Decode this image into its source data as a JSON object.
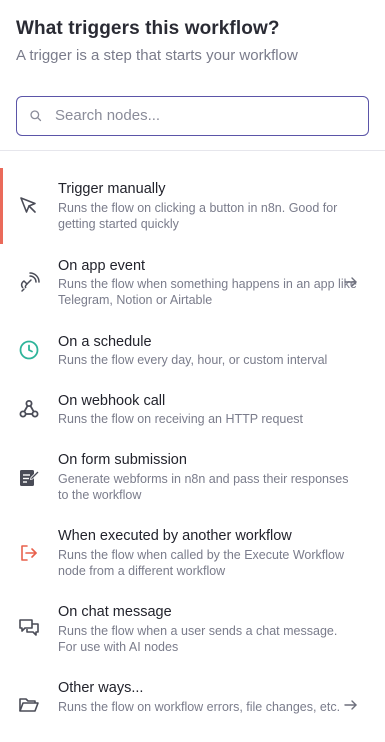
{
  "header": {
    "title": "What triggers this workflow?",
    "subtitle": "A trigger is a step that starts your workflow"
  },
  "search": {
    "placeholder": "Search nodes...",
    "value": ""
  },
  "colors": {
    "accent_active": "#ea6a5a",
    "search_border": "#5b55a8",
    "schedule_icon": "#2eb49a",
    "workflow_icon": "#e8604c"
  },
  "triggers": [
    {
      "name": "Trigger manually",
      "description": "Runs the flow on clicking a button in n8n. Good for getting started quickly",
      "icon": "cursor-icon",
      "active": true,
      "has_arrow": false
    },
    {
      "name": "On app event",
      "description": "Runs the flow when something happens in an app like Telegram, Notion or Airtable",
      "icon": "app-event-icon",
      "active": false,
      "has_arrow": true
    },
    {
      "name": "On a schedule",
      "description": "Runs the flow every day, hour, or custom interval",
      "icon": "clock-icon",
      "active": false,
      "has_arrow": false
    },
    {
      "name": "On webhook call",
      "description": "Runs the flow on receiving an HTTP request",
      "icon": "webhook-icon",
      "active": false,
      "has_arrow": false
    },
    {
      "name": "On form submission",
      "description": "Generate webforms in n8n and pass their responses to the workflow",
      "icon": "form-icon",
      "active": false,
      "has_arrow": false
    },
    {
      "name": "When executed by another workflow",
      "description": "Runs the flow when called by the Execute Workflow node from a different workflow",
      "icon": "sign-in-icon",
      "active": false,
      "has_arrow": false
    },
    {
      "name": "On chat message",
      "description": "Runs the flow when a user sends a chat message. For use with AI nodes",
      "icon": "chat-icon",
      "active": false,
      "has_arrow": false
    },
    {
      "name": "Other ways...",
      "description": "Runs the flow on workflow errors, file changes, etc.",
      "icon": "folder-open-icon",
      "active": false,
      "has_arrow": true
    }
  ]
}
